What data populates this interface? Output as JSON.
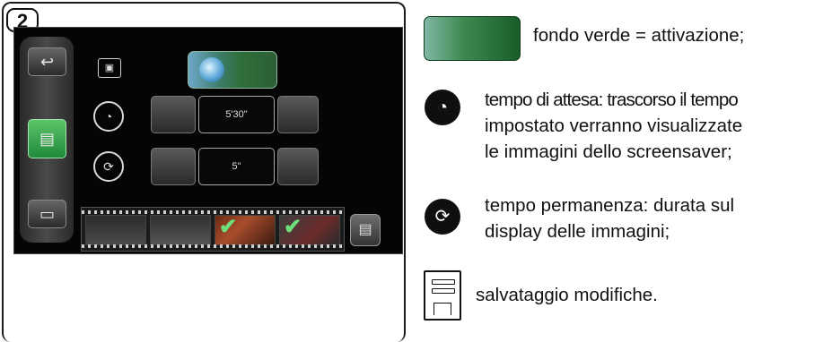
{
  "step": "2",
  "screen": {
    "wait_time_value": "5'30\"",
    "duration_value": "5\""
  },
  "legend": {
    "green": "fondo verde = attivazione;",
    "wait_line1": "tempo di attesa: trascorso il tempo",
    "wait_line2": "impostato verranno visualizzate",
    "wait_line3": "le immagini dello screensaver;",
    "perm_line1": "tempo permanenza: durata sul",
    "perm_line2": "display delle immagini;",
    "save": "salvataggio modifiche."
  },
  "colors": {
    "active_green": "#1f8a3a",
    "screen_bg": "#050505"
  }
}
